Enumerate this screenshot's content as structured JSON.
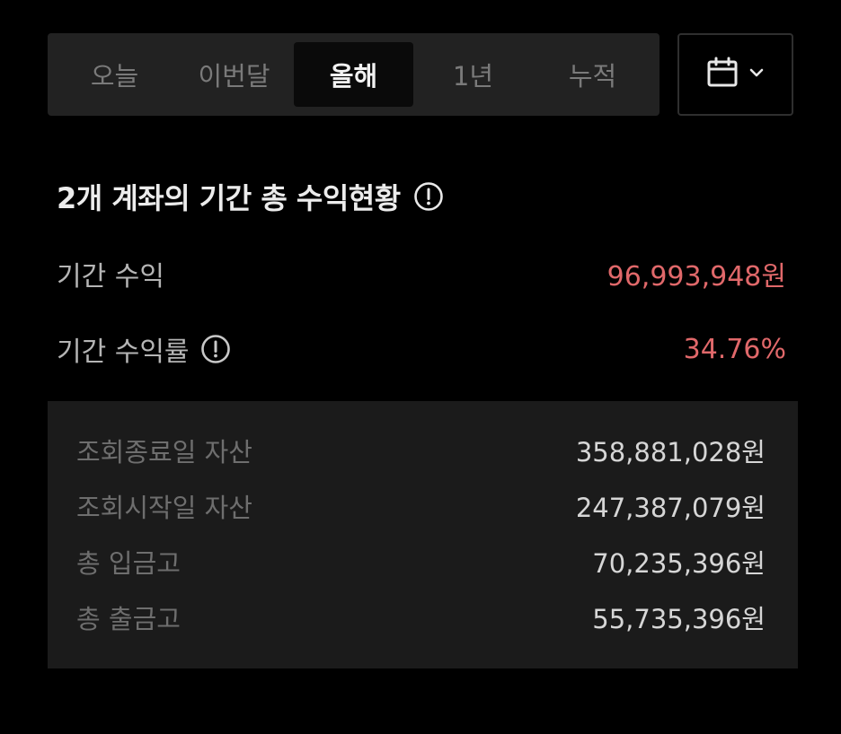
{
  "period_tabs": [
    {
      "label": "오늘",
      "active": false
    },
    {
      "label": "이번달",
      "active": false
    },
    {
      "label": "올해",
      "active": true
    },
    {
      "label": "1년",
      "active": false
    },
    {
      "label": "누적",
      "active": false
    }
  ],
  "date_picker": {
    "icons": [
      "calendar-icon",
      "chevron-down-icon"
    ]
  },
  "summary": {
    "title": "2개 계좌의 기간 총 수익현황",
    "period_profit_label": "기간 수익",
    "period_profit_value": "96,993,948원",
    "period_return_label": "기간 수익률",
    "period_return_value": "34.76%"
  },
  "details": [
    {
      "label": "조회종료일 자산",
      "value": "358,881,028원"
    },
    {
      "label": "조회시작일 자산",
      "value": "247,387,079원"
    },
    {
      "label": "총 입금고",
      "value": "70,235,396원"
    },
    {
      "label": "총 출금고",
      "value": "55,735,396원"
    }
  ],
  "colors": {
    "background": "#000000",
    "profit": "#e0686a",
    "tab_bar": "#222222",
    "details_bg": "#1b1b1b"
  }
}
